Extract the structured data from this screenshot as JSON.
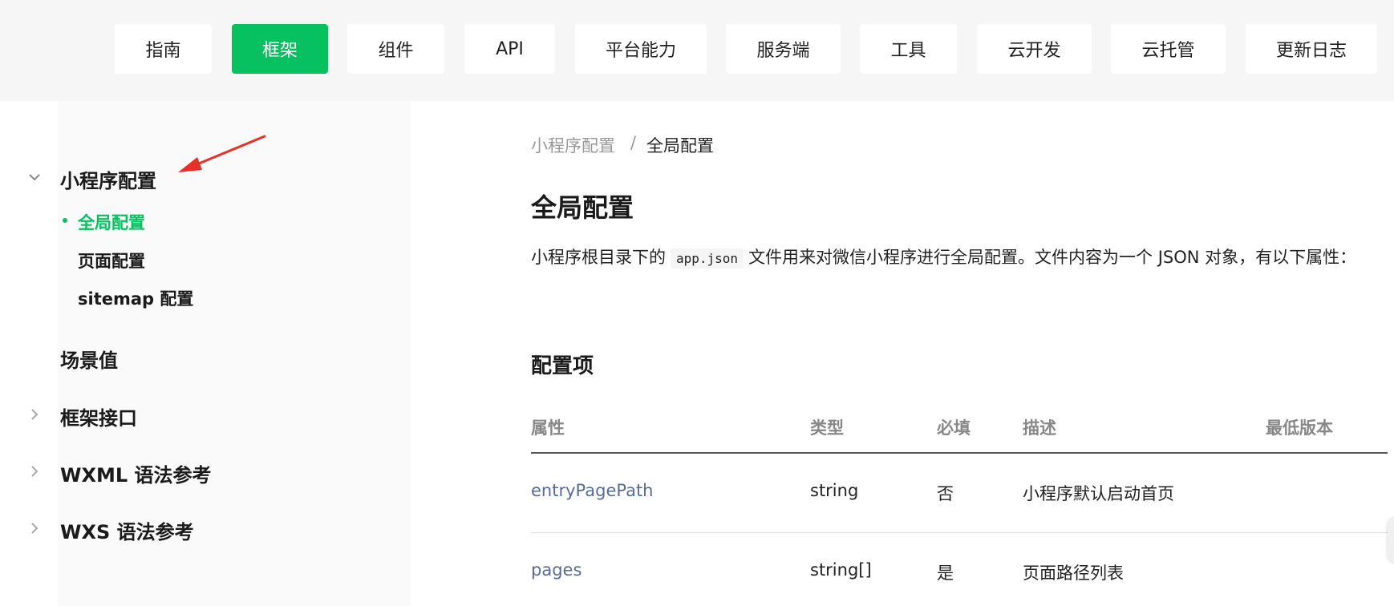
{
  "nav": {
    "items": [
      {
        "label": "指南",
        "active": false
      },
      {
        "label": "框架",
        "active": true
      },
      {
        "label": "组件",
        "active": false
      },
      {
        "label": "API",
        "active": false
      },
      {
        "label": "平台能力",
        "active": false
      },
      {
        "label": "服务端",
        "active": false
      },
      {
        "label": "工具",
        "active": false
      },
      {
        "label": "云开发",
        "active": false
      },
      {
        "label": "云托管",
        "active": false
      },
      {
        "label": "更新日志",
        "active": false
      }
    ]
  },
  "sidebar": {
    "groups": [
      {
        "label": "小程序配置",
        "chevron": "chevron-down-icon",
        "expanded": true
      },
      {
        "label": "场景值",
        "chevron": "",
        "expanded": false
      },
      {
        "label": "框架接口",
        "chevron": "chevron-right-icon",
        "expanded": false
      },
      {
        "label": "WXML 语法参考",
        "chevron": "chevron-right-icon",
        "expanded": false
      },
      {
        "label": "WXS 语法参考",
        "chevron": "chevron-right-icon",
        "expanded": false
      }
    ],
    "subitems": [
      {
        "label": "全局配置",
        "active": true
      },
      {
        "label": "页面配置",
        "active": false
      },
      {
        "label": "sitemap 配置",
        "active": false
      }
    ]
  },
  "breadcrumb": {
    "parent": "小程序配置",
    "separator": "/",
    "current": "全局配置"
  },
  "content": {
    "title": "全局配置",
    "intro_before": "小程序根目录下的",
    "intro_code": "app.json",
    "intro_after": "文件用来对微信小程序进行全局配置。文件内容为一个 JSON 对象，有以下属性：",
    "section_title": "配置项"
  },
  "table": {
    "headers": [
      "属性",
      "类型",
      "必填",
      "描述",
      "最低版本"
    ],
    "rows": [
      {
        "property": "entryPagePath",
        "type": "string",
        "required": "否",
        "description": "小程序默认启动首页",
        "min_version": ""
      },
      {
        "property": "pages",
        "type": "string[]",
        "required": "是",
        "description": "页面路径列表",
        "min_version": ""
      }
    ]
  },
  "colors": {
    "accent": "#07c160",
    "link": "#576b95",
    "annotation_arrow": "#e8302a"
  }
}
